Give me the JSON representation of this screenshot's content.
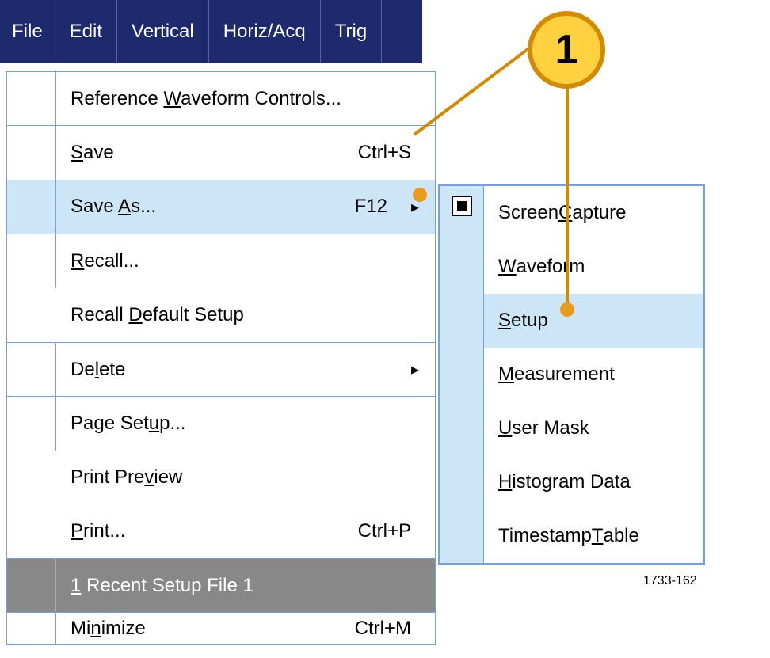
{
  "menubar": {
    "file": "File",
    "edit": "Edit",
    "vertical": "Vertical",
    "horiz_acq": "Horiz/Acq",
    "trig": "Trig"
  },
  "dropdown": {
    "ref_waveform": {
      "pre": "Reference ",
      "u": "W",
      "post": "aveform Controls..."
    },
    "save": {
      "pre": "",
      "u": "S",
      "post": "ave",
      "shortcut": "Ctrl+S"
    },
    "save_as": {
      "pre": "Save ",
      "u": "A",
      "post": "s...",
      "shortcut": "F12"
    },
    "recall": {
      "pre": "",
      "u": "R",
      "post": "ecall..."
    },
    "recall_default": {
      "pre": "Recall ",
      "u": "D",
      "post": "efault Setup"
    },
    "delete": {
      "pre": "De",
      "u": "l",
      "post": "ete"
    },
    "page_setup": {
      "pre": "Page Set",
      "u": "u",
      "post": "p..."
    },
    "print_preview": {
      "pre": "Print Pre",
      "u": "v",
      "post": "iew"
    },
    "print": {
      "pre": "",
      "u": "P",
      "post": "rint...",
      "shortcut": "Ctrl+P"
    },
    "recent": {
      "pre": "",
      "u": "1",
      "post": " Recent Setup File 1"
    },
    "minimize": {
      "pre": "Mi",
      "u": "n",
      "post": "imize",
      "shortcut": "Ctrl+M"
    }
  },
  "submenu": {
    "screen_capture": {
      "pre": "Screen ",
      "u": "C",
      "post": "apture"
    },
    "waveform": {
      "pre": "",
      "u": "W",
      "post": "aveform"
    },
    "setup": {
      "pre": "",
      "u": "S",
      "post": "etup"
    },
    "measurement": {
      "pre": "",
      "u": "M",
      "post": "easurement"
    },
    "user_mask": {
      "pre": "",
      "u": "U",
      "post": "ser Mask"
    },
    "histogram": {
      "pre": "",
      "u": "H",
      "post": "istogram Data"
    },
    "timestamp": {
      "pre": "Timestamp ",
      "u": "T",
      "post": "able"
    }
  },
  "callout": {
    "number": "1"
  },
  "footer": {
    "id": "1733-162"
  }
}
